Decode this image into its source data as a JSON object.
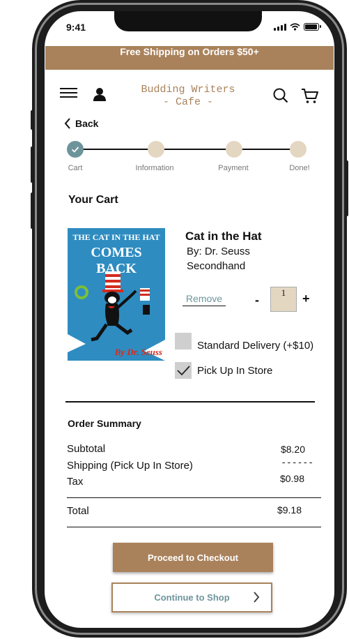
{
  "status_bar": {
    "time": "9:41"
  },
  "promo_banner": {
    "text": "Free Shipping on Orders $50+"
  },
  "header": {
    "logo_line1": "Budding Writers",
    "logo_line2": "- Cafe -"
  },
  "nav": {
    "back_label": "Back"
  },
  "steps": [
    {
      "label": "Cart",
      "done": true
    },
    {
      "label": "Information",
      "done": false
    },
    {
      "label": "Payment",
      "done": false
    },
    {
      "label": "Done!",
      "done": false
    }
  ],
  "cart": {
    "heading": "Your Cart",
    "item": {
      "cover_title_line1": "THE CAT IN THE HAT",
      "cover_title_line2": "COMES BACK",
      "cover_author": "By Dr. Seuss",
      "title": "Cat in the Hat",
      "author": "By: Dr. Seuss",
      "condition": "Secondhand",
      "remove_label": "Remove",
      "quantity": "1",
      "minus_label": "-",
      "plus_label": "+"
    },
    "delivery_options": [
      {
        "label": "Standard Delivery (+$10)",
        "checked": false
      },
      {
        "label": "Pick Up In Store",
        "checked": true
      }
    ]
  },
  "summary": {
    "heading": "Order Summary",
    "subtotal_label": "Subtotal",
    "subtotal_value": "$8.20",
    "shipping_label": "Shipping (Pick Up In Store)",
    "shipping_value": "------",
    "tax_label": "Tax",
    "tax_value": "$0.98",
    "total_label": "Total",
    "total_value": "$9.18"
  },
  "actions": {
    "checkout_label": "Proceed to Checkout",
    "continue_label": "Continue to Shop"
  },
  "colors": {
    "accent": "#a9825b",
    "teal": "#6e949b",
    "beige": "#e4d7c2"
  }
}
